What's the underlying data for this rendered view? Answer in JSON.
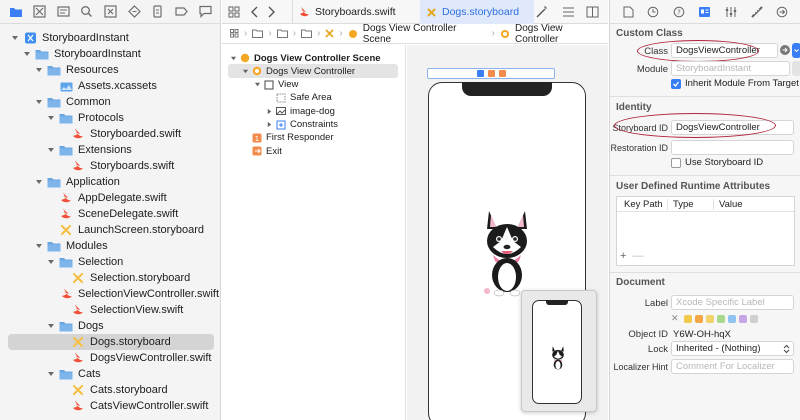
{
  "navigator": {
    "tree": [
      {
        "label": "StoryboardInstant",
        "type": "project",
        "level": 0,
        "expanded": true
      },
      {
        "label": "StoryboardInstant",
        "type": "folder",
        "level": 1,
        "expanded": true
      },
      {
        "label": "Resources",
        "type": "folder",
        "level": 2,
        "expanded": true
      },
      {
        "label": "Assets.xcassets",
        "type": "assets",
        "level": 3
      },
      {
        "label": "Common",
        "type": "folder",
        "level": 2,
        "expanded": true
      },
      {
        "label": "Protocols",
        "type": "folder",
        "level": 3,
        "expanded": true
      },
      {
        "label": "Storyboarded.swift",
        "type": "swift",
        "level": 4
      },
      {
        "label": "Extensions",
        "type": "folder",
        "level": 3,
        "expanded": true
      },
      {
        "label": "Storyboards.swift",
        "type": "swift",
        "level": 4
      },
      {
        "label": "Application",
        "type": "folder",
        "level": 2,
        "expanded": true
      },
      {
        "label": "AppDelegate.swift",
        "type": "swift",
        "level": 3
      },
      {
        "label": "SceneDelegate.swift",
        "type": "swift",
        "level": 3
      },
      {
        "label": "LaunchScreen.storyboard",
        "type": "storyboard",
        "level": 3
      },
      {
        "label": "Modules",
        "type": "folder",
        "level": 2,
        "expanded": true
      },
      {
        "label": "Selection",
        "type": "folder",
        "level": 3,
        "expanded": true
      },
      {
        "label": "Selection.storyboard",
        "type": "storyboard",
        "level": 4
      },
      {
        "label": "SelectionViewController.swift",
        "type": "swift",
        "level": 4
      },
      {
        "label": "SelectionView.swift",
        "type": "swift",
        "level": 4
      },
      {
        "label": "Dogs",
        "type": "folder",
        "level": 3,
        "expanded": true
      },
      {
        "label": "Dogs.storyboard",
        "type": "storyboard",
        "level": 4,
        "selected": true
      },
      {
        "label": "DogsViewController.swift",
        "type": "swift",
        "level": 4
      },
      {
        "label": "Cats",
        "type": "folder",
        "level": 3,
        "expanded": true
      },
      {
        "label": "Cats.storyboard",
        "type": "storyboard",
        "level": 4
      },
      {
        "label": "CatsViewController.swift",
        "type": "swift",
        "level": 4
      }
    ]
  },
  "editor": {
    "tabs": [
      {
        "label": "Storyboards.swift",
        "active": false
      },
      {
        "label": "Dogs.storyboard",
        "active": true
      }
    ],
    "jump_bar": [
      "Dogs View Controller Scene",
      "Dogs View Controller"
    ],
    "outline": [
      {
        "label": "Dogs View Controller Scene",
        "level": 0,
        "icon": "scene",
        "header": true
      },
      {
        "label": "Dogs View Controller",
        "level": 1,
        "icon": "vc",
        "expanded": true,
        "selected": true
      },
      {
        "label": "View",
        "level": 2,
        "icon": "view",
        "expanded": true
      },
      {
        "label": "Safe Area",
        "level": 3,
        "icon": "safe"
      },
      {
        "label": "image-dog",
        "level": 3,
        "icon": "image",
        "collapsed": true
      },
      {
        "label": "Constraints",
        "level": 3,
        "icon": "constraints",
        "collapsed": true
      },
      {
        "label": "First Responder",
        "level": 1,
        "icon": "responder"
      },
      {
        "label": "Exit",
        "level": 1,
        "icon": "exit"
      }
    ]
  },
  "inspector": {
    "custom_class": {
      "title": "Custom Class",
      "class_label": "Class",
      "class_value": "DogsViewController",
      "module_label": "Module",
      "module_placeholder": "StoryboardInstant",
      "inherit_label": "Inherit Module From Target"
    },
    "identity": {
      "title": "Identity",
      "storyboard_id_label": "Storyboard ID",
      "storyboard_id_value": "DogsViewController",
      "restoration_id_label": "Restoration ID",
      "use_storyboard_id_label": "Use Storyboard ID"
    },
    "runtime_attributes": {
      "title": "User Defined Runtime Attributes",
      "columns": [
        "Key Path",
        "Type",
        "Value"
      ],
      "add": "+",
      "remove": "—"
    },
    "document": {
      "title": "Document",
      "label_label": "Label",
      "label_placeholder": "Xcode Specific Label",
      "clear_mark": "✕",
      "swatches": [
        "#f2c94c",
        "#f4a742",
        "#f1d36b",
        "#a7d98b",
        "#8fc4f1",
        "#c7a6e6",
        "#cfcfcf"
      ],
      "object_id_label": "Object ID",
      "object_id_value": "Y6W-OH-hqX",
      "lock_label": "Lock",
      "lock_value": "Inherited - (Nothing)",
      "localizer_label": "Localizer Hint",
      "localizer_placeholder": "Comment For Localizer"
    }
  },
  "colors": {
    "accent": "#3a7ef5",
    "annotation": "#b0253a",
    "folder": "#6aa6e3",
    "swift": "#f05138",
    "storyboard": "#f5c146"
  }
}
